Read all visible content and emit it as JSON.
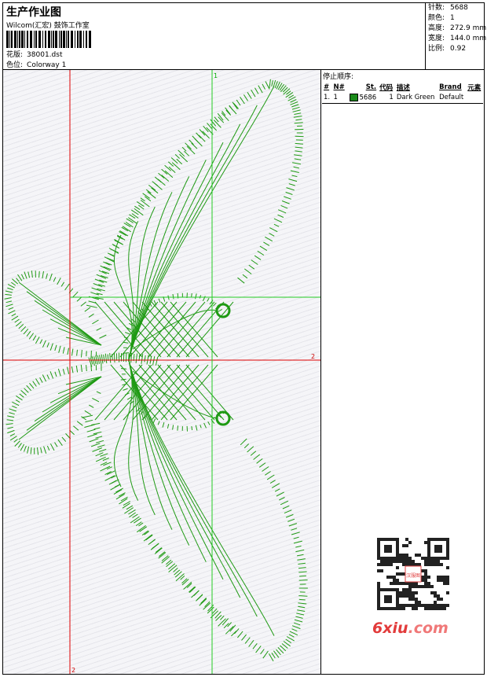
{
  "header": {
    "title": "生产作业图",
    "subtitle": "Wilcom(汇宏) 鼓饰工作室",
    "design_label": "花版:",
    "design_value": "38001.dst",
    "colorway_label": "色位:",
    "colorway_value": "Colorway 1"
  },
  "info": {
    "stitches_label": "针数:",
    "stitches_value": "5688",
    "colors_label": "颜色:",
    "colors_value": "1",
    "height_label": "高度:",
    "height_value": "272.9 mm",
    "width_label": "宽度:",
    "width_value": "144.0 mm",
    "scale_label": "比例:",
    "scale_value": "0.92"
  },
  "guides": {
    "label_top_green": "1",
    "label_right_red": "2",
    "label_bottom_red": "2",
    "color_red": "#dd0000",
    "color_green": "#22cc22"
  },
  "stop_sequence": {
    "title": "停止顺序:",
    "columns": [
      "#",
      "N#",
      "St.",
      "代码",
      "描述",
      "Brand",
      "元素"
    ],
    "rows": [
      {
        "index": "1.",
        "n": "1",
        "color": "#1a8a1a",
        "stitches": "5686",
        "code": "1",
        "description": "Dark Green",
        "brand": "Default",
        "element": ""
      }
    ]
  },
  "design_color": "#1f9a14",
  "watermark": {
    "qr_center_text": "汉服图",
    "logo_part1": "6xiu",
    "logo_part2": ".com"
  }
}
